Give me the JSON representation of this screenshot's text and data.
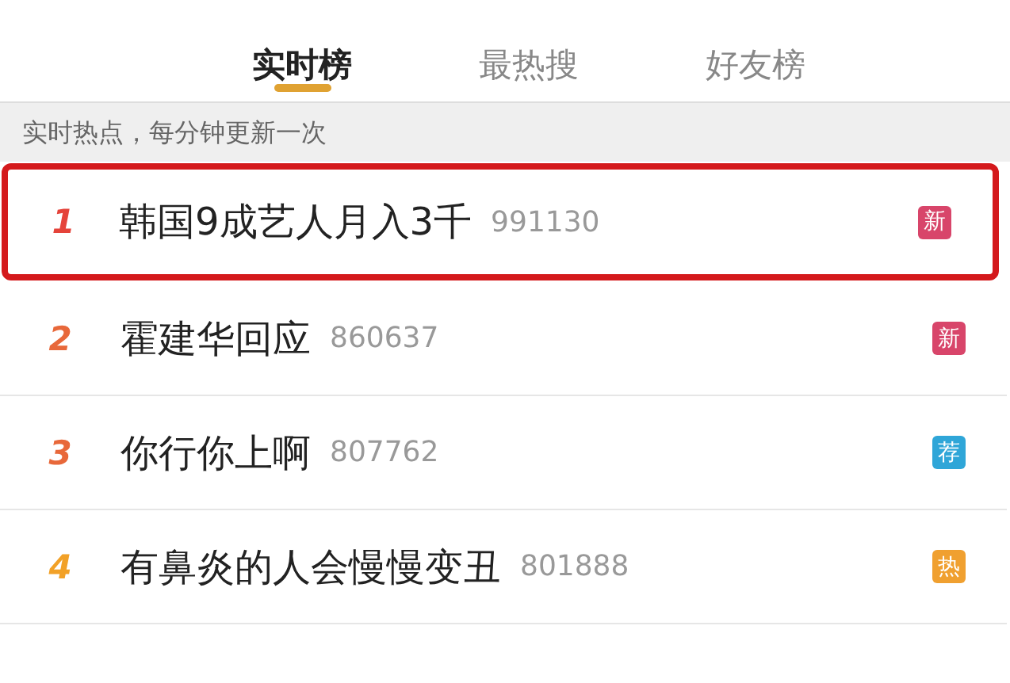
{
  "tabs": [
    {
      "label": "实时榜",
      "selected": true
    },
    {
      "label": "最热搜",
      "selected": false
    },
    {
      "label": "好友榜",
      "selected": false
    }
  ],
  "notice": "实时热点，每分钟更新一次",
  "rows": [
    {
      "rank": "1",
      "title": "韩国9成艺人月入3千",
      "count": "991130",
      "badge": {
        "kind": "new",
        "text": "新"
      },
      "highlighted": true
    },
    {
      "rank": "2",
      "title": "霍建华回应",
      "count": "860637",
      "badge": {
        "kind": "new",
        "text": "新"
      },
      "highlighted": false
    },
    {
      "rank": "3",
      "title": "你行你上啊",
      "count": "807762",
      "badge": {
        "kind": "recommended",
        "text": "荐"
      },
      "highlighted": false
    },
    {
      "rank": "4",
      "title": "有鼻炎的人会慢慢变丑",
      "count": "801888",
      "badge": {
        "kind": "hot",
        "text": "热"
      },
      "highlighted": false
    }
  ]
}
